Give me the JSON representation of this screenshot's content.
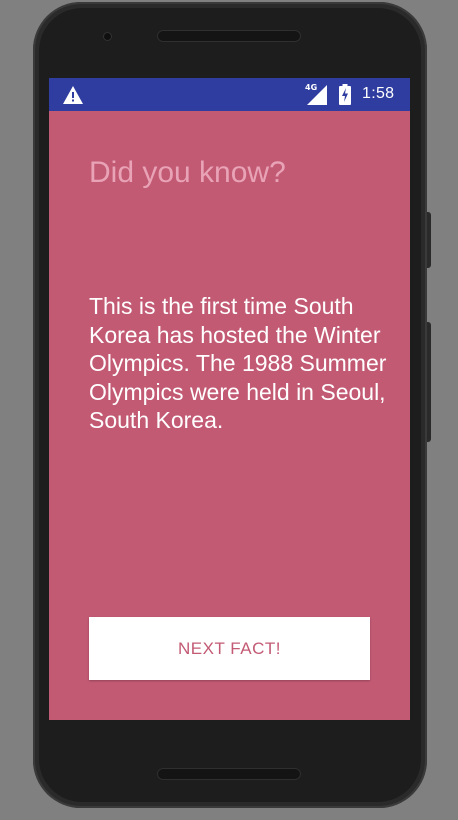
{
  "status_bar": {
    "network_label": "4G",
    "time": "1:58",
    "icons": [
      "warning-icon",
      "cellular-signal-icon",
      "battery-charging-icon"
    ]
  },
  "content": {
    "title": "Did you know?",
    "fact": "This is the first time South Korea has hosted the Winter Olympics. The 1988 Summer Olympics were held in Seoul, South Korea.",
    "next_button_label": "NEXT FACT!"
  },
  "colors": {
    "background": "#c35a74",
    "status_bar": "#2e3d9f",
    "title_text": "#e9a3b6",
    "fact_text": "#ffffff",
    "button_bg": "#ffffff",
    "button_text": "#c35a74"
  }
}
